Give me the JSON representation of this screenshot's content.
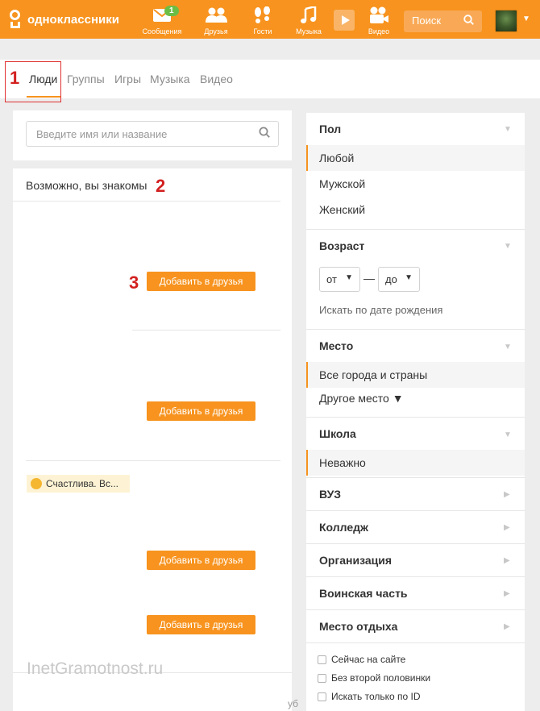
{
  "header": {
    "logo_text": "одноклассники",
    "nav": [
      {
        "label": "Сообщения",
        "icon": "envelope-icon",
        "badge": "1"
      },
      {
        "label": "Друзья",
        "icon": "friends-icon"
      },
      {
        "label": "Гости",
        "icon": "footprints-icon"
      },
      {
        "label": "Музыка",
        "icon": "music-note-icon"
      },
      {
        "label": "Видео",
        "icon": "video-camera-icon"
      }
    ],
    "search_placeholder": "Поиск"
  },
  "tabs": [
    {
      "label": "Люди",
      "active": true
    },
    {
      "label": "Группы"
    },
    {
      "label": "Игры"
    },
    {
      "label": "Музыка"
    },
    {
      "label": "Видео"
    }
  ],
  "annotations": [
    "1",
    "2",
    "3"
  ],
  "people": {
    "search_placeholder": "Введите имя или название",
    "section_title": "Возможно, вы знакомы",
    "add_button_label": "Добавить в друзья",
    "status_text": "Счастлива. Вс..."
  },
  "filters": {
    "gender": {
      "title": "Пол",
      "options": [
        "Любой",
        "Мужской",
        "Женский"
      ],
      "selected": "Любой"
    },
    "age": {
      "title": "Возраст",
      "from": "от",
      "to": "до",
      "birthdate_link": "Искать по дате рождения"
    },
    "place": {
      "title": "Место",
      "options": [
        "Все города и страны",
        "Другое место ▼"
      ],
      "selected": "Все города и страны"
    },
    "school": {
      "title": "Школа",
      "selected": "Неважно"
    },
    "collapsed": [
      "ВУЗ",
      "Колледж",
      "Организация",
      "Воинская часть",
      "Место отдыха"
    ],
    "checkboxes": [
      "Сейчас на сайте",
      "Без второй половинки",
      "Искать только по ID"
    ]
  },
  "watermark": "InetGramotnost.ru",
  "cut_text": "уб",
  "colors": {
    "accent": "#f7931e",
    "badge": "#6cbd45",
    "annotation": "#d32020"
  }
}
